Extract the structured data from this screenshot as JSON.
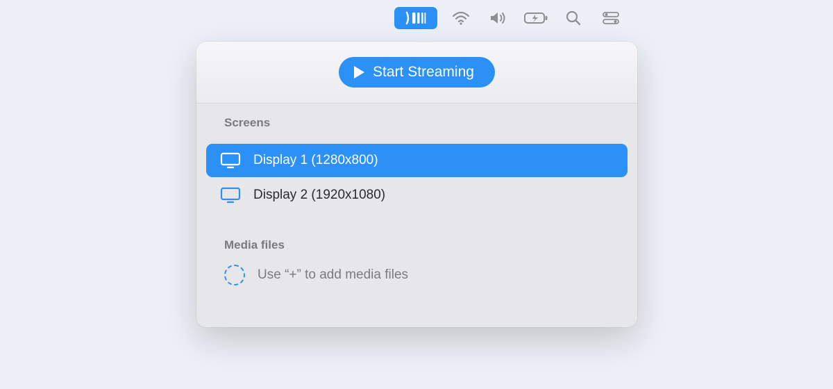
{
  "menubar": {
    "items": [
      {
        "name": "streaming-icon",
        "active": true
      },
      {
        "name": "wifi-icon"
      },
      {
        "name": "volume-icon"
      },
      {
        "name": "battery-icon"
      },
      {
        "name": "search-icon"
      },
      {
        "name": "control-center-icon"
      }
    ]
  },
  "popover": {
    "start_button": "Start Streaming",
    "screens_title": "Screens",
    "screens": [
      {
        "label": "Display 1 (1280x800)",
        "selected": true
      },
      {
        "label": "Display 2 (1920x1080)",
        "selected": false
      }
    ],
    "media_title": "Media files",
    "media_placeholder": "Use “+” to add media files"
  },
  "colors": {
    "accent": "#2b91f6",
    "panel": "#e7e7e9",
    "muted": "#7a7a80"
  }
}
